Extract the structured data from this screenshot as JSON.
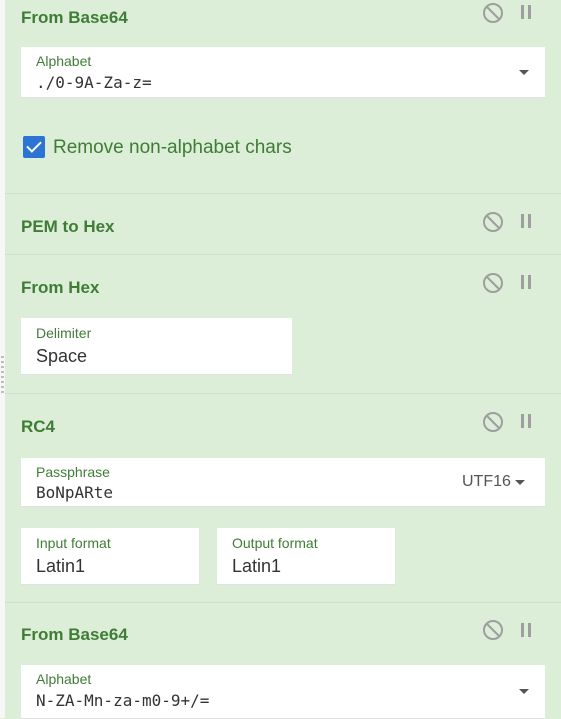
{
  "operations": [
    {
      "title": "From Base64",
      "alphabet_label": "Alphabet",
      "alphabet_value": "./0-9A-Za-z=",
      "remove_label": "Remove non-alphabet chars",
      "remove_checked": true
    },
    {
      "title": "PEM to Hex"
    },
    {
      "title": "From Hex",
      "delimiter_label": "Delimiter",
      "delimiter_value": "Space"
    },
    {
      "title": "RC4",
      "passphrase_label": "Passphrase",
      "passphrase_value": "BoNpARte",
      "passphrase_encoding": "UTF16",
      "input_format_label": "Input format",
      "input_format_value": "Latin1",
      "output_format_label": "Output format",
      "output_format_value": "Latin1"
    },
    {
      "title": "From Base64",
      "alphabet_label": "Alphabet",
      "alphabet_value": "N-ZA-Mn-za-m0-9+/="
    }
  ],
  "colors": {
    "panel": "#dcedd8",
    "accent": "#3f7d36",
    "checkbox": "#2b74d3"
  },
  "icons": {
    "disable": "disable-icon",
    "pause": "pause-icon",
    "dropdown": "chevron-down-icon"
  }
}
